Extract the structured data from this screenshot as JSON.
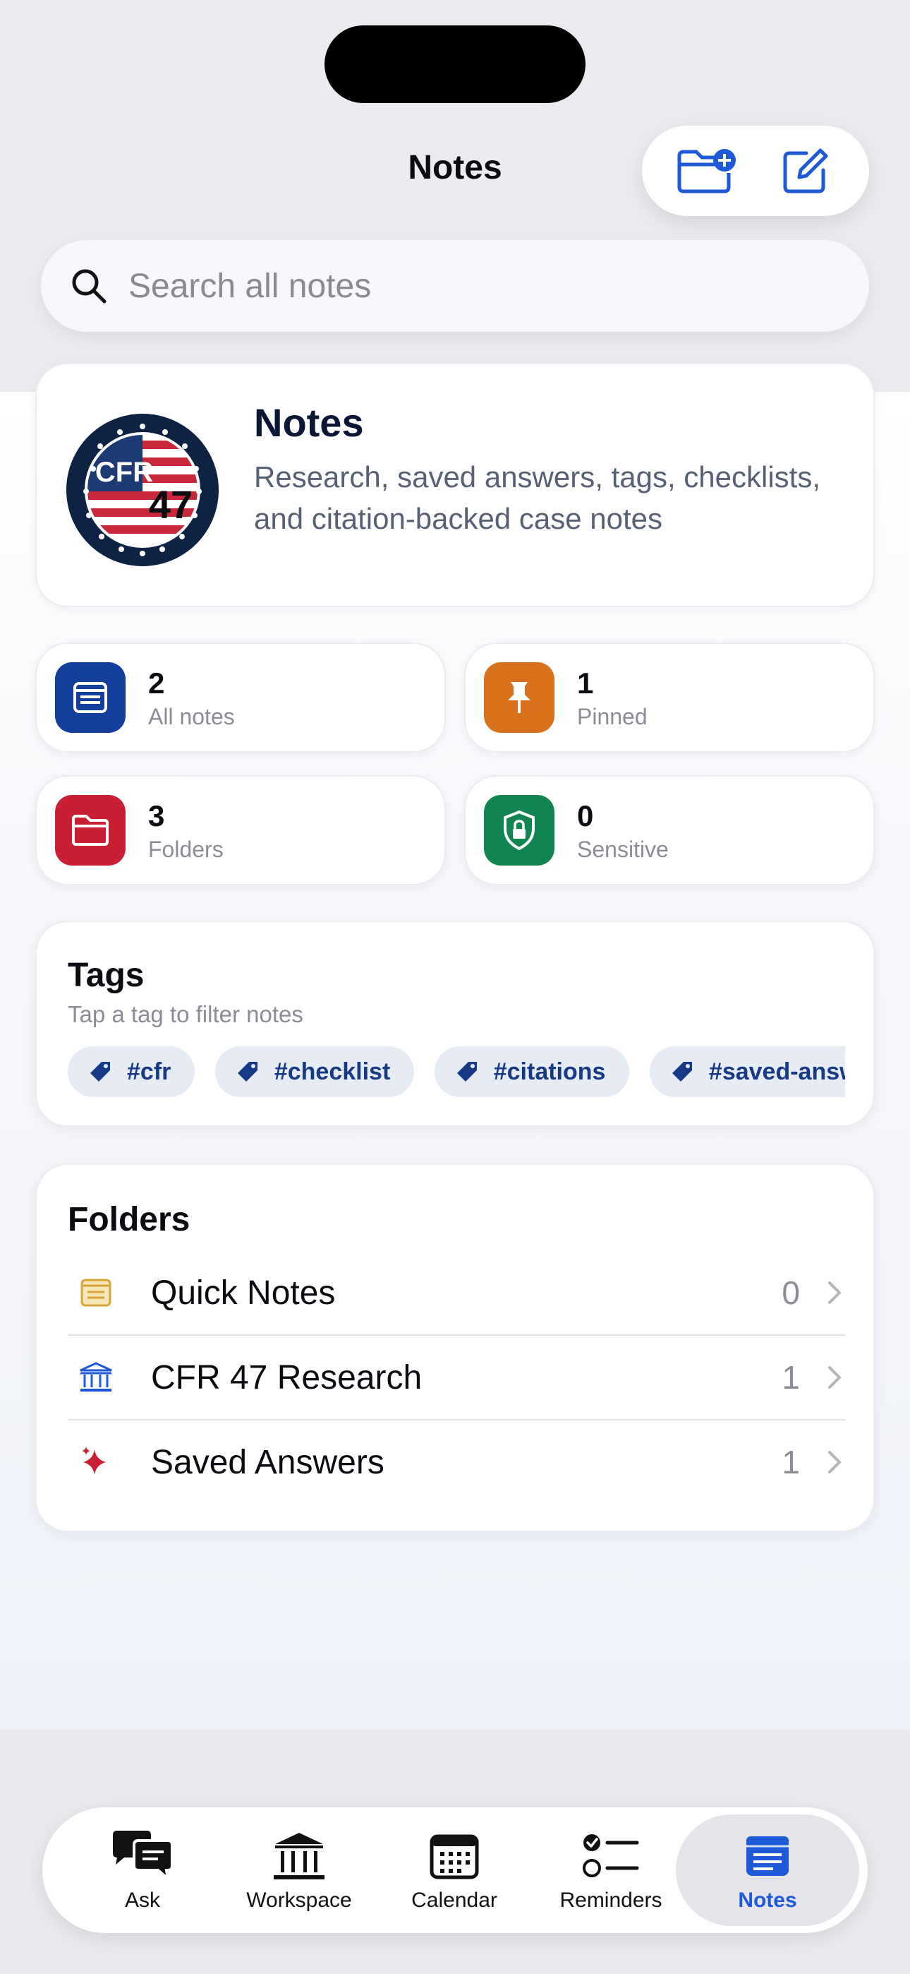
{
  "nav": {
    "title": "Notes"
  },
  "search": {
    "placeholder": "Search all notes"
  },
  "hero": {
    "title": "Notes",
    "subtitle": "Research, saved answers, tags, checklists, and citation-backed case notes",
    "logo_text": "CFR",
    "logo_number": "47"
  },
  "stats": [
    {
      "value": "2",
      "label": "All notes",
      "icon": "document-icon",
      "color": "#143e9c"
    },
    {
      "value": "1",
      "label": "Pinned",
      "icon": "pin-icon",
      "color": "#d9721c"
    },
    {
      "value": "3",
      "label": "Folders",
      "icon": "folder-icon",
      "color": "#c91f33"
    },
    {
      "value": "0",
      "label": "Sensitive",
      "icon": "lock-shield-icon",
      "color": "#118452"
    }
  ],
  "tags": {
    "title": "Tags",
    "subtitle": "Tap a tag to filter notes",
    "items": [
      "#cfr",
      "#checklist",
      "#citations",
      "#saved-answers"
    ]
  },
  "folders": {
    "title": "Folders",
    "items": [
      {
        "name": "Quick Notes",
        "count": "0",
        "icon": "note-icon"
      },
      {
        "name": "CFR 47 Research",
        "count": "1",
        "icon": "building-columns-icon"
      },
      {
        "name": "Saved Answers",
        "count": "1",
        "icon": "sparkles-icon"
      }
    ]
  },
  "tabbar": {
    "items": [
      {
        "label": "Ask",
        "icon": "chat-bubbles-icon"
      },
      {
        "label": "Workspace",
        "icon": "building-columns-icon"
      },
      {
        "label": "Calendar",
        "icon": "calendar-icon"
      },
      {
        "label": "Reminders",
        "icon": "checklist-icon"
      },
      {
        "label": "Notes",
        "icon": "notes-icon",
        "active": true
      }
    ]
  },
  "colors": {
    "accent": "#1e5ad7",
    "navy": "#0c1735",
    "chip_text": "#163a86"
  }
}
